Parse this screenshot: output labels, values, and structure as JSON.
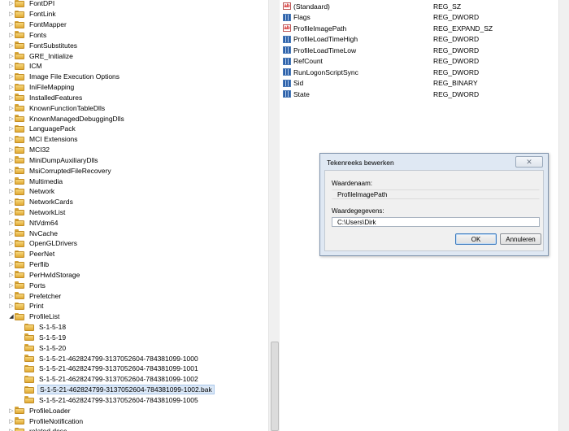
{
  "tree": {
    "items": [
      {
        "label": "FontDPI",
        "level": 0,
        "expanded": false
      },
      {
        "label": "FontLink",
        "level": 0,
        "expanded": false
      },
      {
        "label": "FontMapper",
        "level": 0,
        "expanded": false
      },
      {
        "label": "Fonts",
        "level": 0,
        "expanded": false
      },
      {
        "label": "FontSubstitutes",
        "level": 0,
        "expanded": false
      },
      {
        "label": "GRE_Initialize",
        "level": 0,
        "expanded": false
      },
      {
        "label": "ICM",
        "level": 0,
        "expanded": false
      },
      {
        "label": "Image File Execution Options",
        "level": 0,
        "expanded": false
      },
      {
        "label": "IniFileMapping",
        "level": 0,
        "expanded": false
      },
      {
        "label": "InstalledFeatures",
        "level": 0,
        "expanded": false
      },
      {
        "label": "KnownFunctionTableDlls",
        "level": 0,
        "expanded": false
      },
      {
        "label": "KnownManagedDebuggingDlls",
        "level": 0,
        "expanded": false
      },
      {
        "label": "LanguagePack",
        "level": 0,
        "expanded": false
      },
      {
        "label": "MCI Extensions",
        "level": 0,
        "expanded": false
      },
      {
        "label": "MCI32",
        "level": 0,
        "expanded": false
      },
      {
        "label": "MiniDumpAuxiliaryDlls",
        "level": 0,
        "expanded": false
      },
      {
        "label": "MsiCorruptedFileRecovery",
        "level": 0,
        "expanded": false
      },
      {
        "label": "Multimedia",
        "level": 0,
        "expanded": false
      },
      {
        "label": "Network",
        "level": 0,
        "expanded": false
      },
      {
        "label": "NetworkCards",
        "level": 0,
        "expanded": false
      },
      {
        "label": "NetworkList",
        "level": 0,
        "expanded": false
      },
      {
        "label": "NtVdm64",
        "level": 0,
        "expanded": false
      },
      {
        "label": "NvCache",
        "level": 0,
        "expanded": false
      },
      {
        "label": "OpenGLDrivers",
        "level": 0,
        "expanded": false
      },
      {
        "label": "PeerNet",
        "level": 0,
        "expanded": false
      },
      {
        "label": "Perflib",
        "level": 0,
        "expanded": false
      },
      {
        "label": "PerHwIdStorage",
        "level": 0,
        "expanded": false
      },
      {
        "label": "Ports",
        "level": 0,
        "expanded": false
      },
      {
        "label": "Prefetcher",
        "level": 0,
        "expanded": false
      },
      {
        "label": "Print",
        "level": 0,
        "expanded": false
      },
      {
        "label": "ProfileList",
        "level": 0,
        "expanded": true
      },
      {
        "label": "S-1-5-18",
        "level": 1
      },
      {
        "label": "S-1-5-19",
        "level": 1
      },
      {
        "label": "S-1-5-20",
        "level": 1
      },
      {
        "label": "S-1-5-21-462824799-3137052604-784381099-1000",
        "level": 1
      },
      {
        "label": "S-1-5-21-462824799-3137052604-784381099-1001",
        "level": 1
      },
      {
        "label": "S-1-5-21-462824799-3137052604-784381099-1002",
        "level": 1
      },
      {
        "label": "S-1-5-21-462824799-3137052604-784381099-1002.bak",
        "level": 1,
        "selected": true
      },
      {
        "label": "S-1-5-21-462824799-3137052604-784381099-1005",
        "level": 1
      },
      {
        "label": "ProfileLoader",
        "level": 0,
        "expanded": false
      },
      {
        "label": "ProfileNotification",
        "level": 0,
        "expanded": false
      },
      {
        "label": "related.desc",
        "level": 0,
        "expanded": false
      }
    ]
  },
  "values": {
    "rows": [
      {
        "name": "(Standaard)",
        "type": "REG_SZ",
        "icon": "string-value-icon"
      },
      {
        "name": "Flags",
        "type": "REG_DWORD",
        "icon": "binary-value-icon"
      },
      {
        "name": "ProfileImagePath",
        "type": "REG_EXPAND_SZ",
        "icon": "string-value-icon"
      },
      {
        "name": "ProfileLoadTimeHigh",
        "type": "REG_DWORD",
        "icon": "binary-value-icon"
      },
      {
        "name": "ProfileLoadTimeLow",
        "type": "REG_DWORD",
        "icon": "binary-value-icon"
      },
      {
        "name": "RefCount",
        "type": "REG_DWORD",
        "icon": "binary-value-icon"
      },
      {
        "name": "RunLogonScriptSync",
        "type": "REG_DWORD",
        "icon": "binary-value-icon"
      },
      {
        "name": "Sid",
        "type": "REG_BINARY",
        "icon": "binary-value-icon"
      },
      {
        "name": "State",
        "type": "REG_DWORD",
        "icon": "binary-value-icon"
      }
    ]
  },
  "dialog": {
    "title": "Tekenreeks bewerken",
    "close_glyph": "✕",
    "name_label": "Waardenaam:",
    "name_value": "ProfileImagePath",
    "data_label": "Waardegegevens:",
    "data_value": "C:\\Users\\Dirk",
    "ok_label": "OK",
    "cancel_label": "Annuleren"
  },
  "icons": {
    "string_glyph": "ab",
    "expand_glyph": "▷",
    "collapse_glyph": "◢"
  },
  "colors": {
    "folder": "#f0c75e",
    "selection": "#dbe8f7",
    "dialog_frame": "#dfe8f3"
  }
}
